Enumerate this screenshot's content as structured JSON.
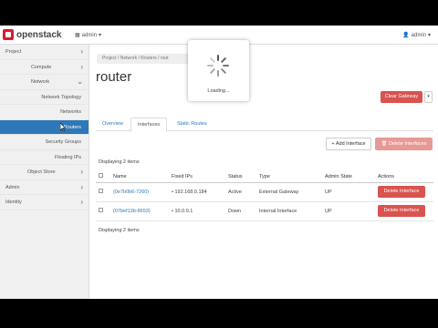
{
  "topbar": {
    "brand": "openstack",
    "project_label": "admin",
    "user_label": "admin"
  },
  "sidebar": {
    "items": [
      {
        "label": "Project",
        "level": 0,
        "chevron": "›"
      },
      {
        "label": "Compute",
        "level": 1,
        "chevron": "›"
      },
      {
        "label": "Network",
        "level": 1,
        "chevron": "⌄"
      },
      {
        "label": "Network Topology",
        "level": 2
      },
      {
        "label": "Networks",
        "level": 2
      },
      {
        "label": "Routers",
        "level": 2,
        "active": true
      },
      {
        "label": "Security Groups",
        "level": 2
      },
      {
        "label": "Floating IPs",
        "level": 2
      },
      {
        "label": "Object Store",
        "level": 1,
        "chevron": "›"
      },
      {
        "label": "Admin",
        "level": 0,
        "chevron": "›"
      },
      {
        "label": "Identity",
        "level": 0,
        "chevron": "›"
      }
    ]
  },
  "breadcrumb": "Project  /  Network  /  Routers  /  rout",
  "page_title": "router",
  "buttons": {
    "clear_gateway": "Clear Gateway",
    "caret": "▾",
    "add_interface": "+ Add Interface",
    "delete_interfaces": "🗑 Delete Interfaces"
  },
  "tabs": [
    "Overview",
    "Interfaces",
    "Static Routes"
  ],
  "summary_top": "Displaying 2 items",
  "summary_bottom": "Displaying 2 items",
  "table": {
    "headers": [
      "",
      "Name",
      "Fixed IPs",
      "Status",
      "Type",
      "Admin State",
      "Actions"
    ],
    "rows": [
      {
        "name": "(0e7b0b6-7260)",
        "fixed_ip": "192.168.0.184",
        "status": "Active",
        "type": "External Gateway",
        "admin_state": "UP",
        "action": "Delete Interface"
      },
      {
        "name": "(07bef13b-8653)",
        "fixed_ip": "10.0.0.1",
        "status": "Down",
        "type": "Internal Interface",
        "admin_state": "UP",
        "action": "Delete Interface"
      }
    ]
  },
  "loading": {
    "text": "Loading..."
  },
  "colors": {
    "accent": "#2e77b8",
    "danger": "#d9534f",
    "brand": "#da1a32"
  }
}
